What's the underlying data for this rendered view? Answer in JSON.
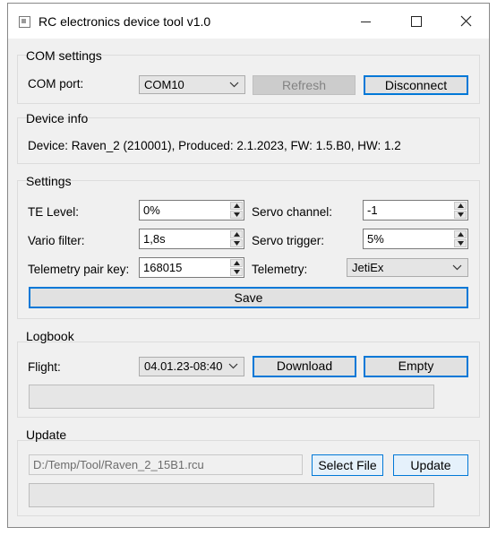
{
  "window": {
    "title": "RC electronics device tool v1.0",
    "icons": {
      "app": "app-icon",
      "minimize": "minimize-icon",
      "maximize": "maximize-icon",
      "close": "close-icon"
    }
  },
  "com": {
    "group_title": "COM settings",
    "port_label": "COM port:",
    "port_value": "COM10",
    "refresh_label": "Refresh",
    "disconnect_label": "Disconnect"
  },
  "device": {
    "group_title": "Device info",
    "info": "Device: Raven_2 (210001), Produced: 2.1.2023, FW: 1.5.B0, HW: 1.2"
  },
  "settings": {
    "group_title": "Settings",
    "te_label": "TE Level:",
    "te_value": "0%",
    "vario_label": "Vario filter:",
    "vario_value": "1,8s",
    "pair_label": "Telemetry pair key:",
    "pair_value": "168015",
    "servo_channel_label": "Servo channel:",
    "servo_channel_value": "-1",
    "servo_trigger_label": "Servo trigger:",
    "servo_trigger_value": "5%",
    "telemetry_label": "Telemetry:",
    "telemetry_value": "JetiEx",
    "save_label": "Save"
  },
  "logbook": {
    "group_title": "Logbook",
    "flight_label": "Flight:",
    "flight_value": "04.01.23-08:40",
    "download_label": "Download",
    "empty_label": "Empty",
    "progress": 0
  },
  "update": {
    "group_title": "Update",
    "file_path": "D:/Temp/Tool/Raven_2_15B1.rcu",
    "select_file_label": "Select File",
    "update_label": "Update",
    "progress": 0
  },
  "colors": {
    "accent": "#0078d7",
    "window_bg": "#f0f0f0",
    "button_bg": "#e1e1e1"
  }
}
